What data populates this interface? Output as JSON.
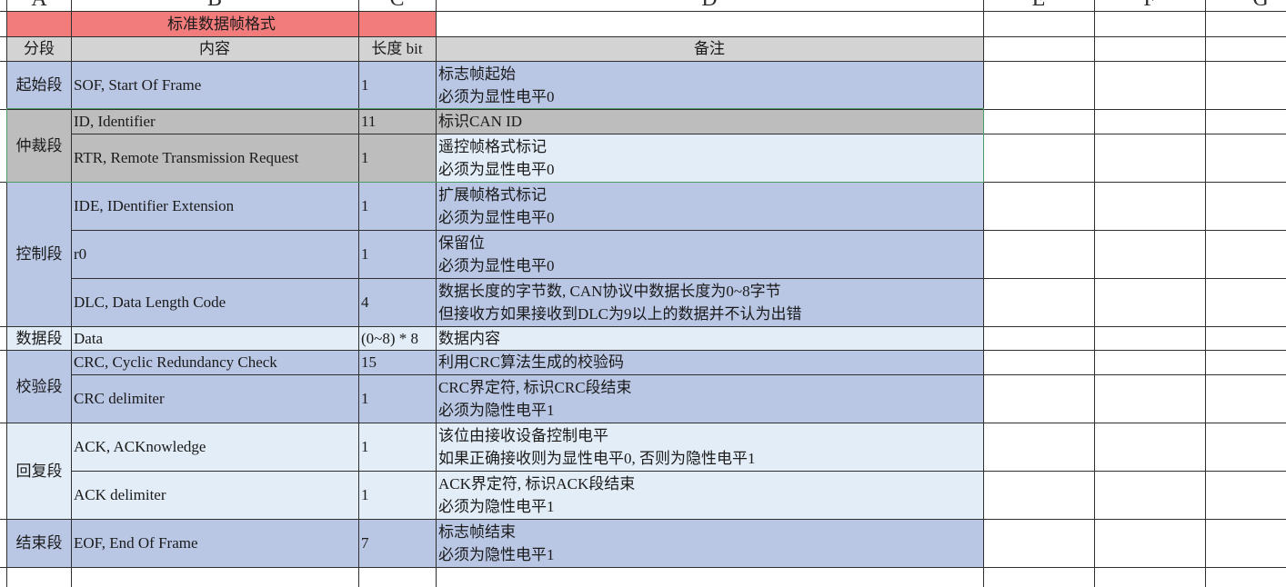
{
  "columns": [
    "A",
    "B",
    "C",
    "D",
    "E",
    "F",
    "G"
  ],
  "title": "标准数据帧格式",
  "headers": {
    "segment": "分段",
    "content": "内容",
    "length": "长度 bit",
    "note": "备注"
  },
  "segments": {
    "sof": "起始段",
    "arb": "仲裁段",
    "ctrl": "控制段",
    "data": "数据段",
    "crc": "校验段",
    "ack": "回复段",
    "eof": "结束段"
  },
  "rows": [
    {
      "content": "SOF, Start Of Frame",
      "length": "1",
      "note1": "标志帧起始",
      "note2": "必须为显性电平0"
    },
    {
      "content": "ID, Identifier",
      "length": "11",
      "note1": "标识CAN ID",
      "note2": ""
    },
    {
      "content": "RTR, Remote Transmission Request",
      "length": "1",
      "note1": "遥控帧格式标记",
      "note2": "必须为显性电平0"
    },
    {
      "content": "IDE, IDentifier Extension",
      "length": "1",
      "note1": "扩展帧格式标记",
      "note2": "必须为显性电平0"
    },
    {
      "content": "r0",
      "length": "1",
      "note1": "保留位",
      "note2": "必须为显性电平0"
    },
    {
      "content": "DLC, Data Length Code",
      "length": "4",
      "note1": "数据长度的字节数, CAN协议中数据长度为0~8字节",
      "note2": "但接收方如果接收到DLC为9以上的数据并不认为出错"
    },
    {
      "content": "Data",
      "length": "(0~8) * 8",
      "note1": "数据内容",
      "note2": ""
    },
    {
      "content": "CRC, Cyclic Redundancy Check",
      "length": "15",
      "note1": "利用CRC算法生成的校验码",
      "note2": ""
    },
    {
      "content": "CRC delimiter",
      "length": "1",
      "note1": "CRC界定符, 标识CRC段结束",
      "note2": "必须为隐性电平1"
    },
    {
      "content": "ACK, ACKnowledge",
      "length": "1",
      "note1": "该位由接收设备控制电平",
      "note2": "如果正确接收则为显性电平0, 否则为隐性电平1"
    },
    {
      "content": "ACK delimiter",
      "length": "1",
      "note1": "ACK界定符, 标识ACK段结束",
      "note2": "必须为隐性电平1"
    },
    {
      "content": "EOF, End Of Frame",
      "length": "7",
      "note1": "标志帧结束",
      "note2": "必须为隐性电平1"
    }
  ],
  "colors": {
    "title": "#f27c7c",
    "header": "#d3d3d3",
    "blue": "#b9c7e5",
    "light": "#e3edf7",
    "gray": "#bdbdbd",
    "selection": "#4c9b67"
  }
}
